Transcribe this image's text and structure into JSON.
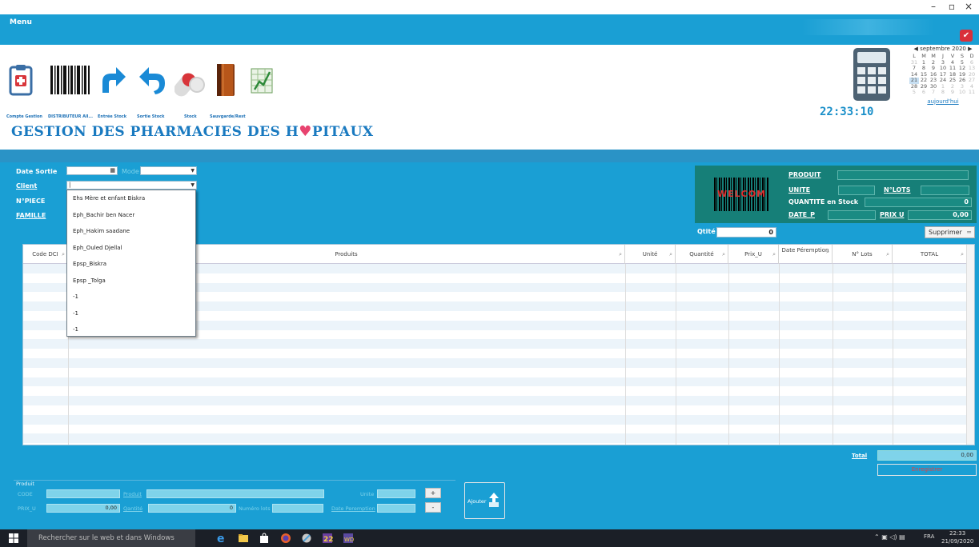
{
  "window": {
    "minimize": "–",
    "maximize": "▫",
    "close": "×"
  },
  "menu": {
    "label": "Menu"
  },
  "toolbar": {
    "labels": [
      "Compte Gestion",
      "DISTRIBUTEUR All...",
      "Entrée Stock",
      "Sortie Stock",
      "Stock",
      "Sauvgarde/Rest"
    ]
  },
  "app_title": {
    "before": "GESTION DES PHARMACIES DES H",
    "heart": "♥",
    "after": "PITAUX"
  },
  "clock": "22:33:10",
  "calendar": {
    "header": "septembre 2020",
    "prev": "◀",
    "next": "▶",
    "days": [
      "L",
      "M",
      "M",
      "J",
      "V",
      "S",
      "D"
    ],
    "weeks": [
      [
        "31",
        "1",
        "2",
        "3",
        "4",
        "5",
        "6"
      ],
      [
        "7",
        "8",
        "9",
        "10",
        "11",
        "12",
        "13"
      ],
      [
        "14",
        "15",
        "16",
        "17",
        "18",
        "19",
        "20"
      ],
      [
        "21",
        "22",
        "23",
        "24",
        "25",
        "26",
        "27"
      ],
      [
        "28",
        "29",
        "30",
        "1",
        "2",
        "3",
        "4"
      ],
      [
        "5",
        "6",
        "7",
        "8",
        "9",
        "10",
        "11"
      ]
    ],
    "today": "aujourd'hui"
  },
  "form": {
    "date_sortie": "Date Sortie",
    "mode": "Mode",
    "client": "Client",
    "client_value": "|",
    "n_piece": "N°PIECE",
    "famille": "FAMILLE"
  },
  "client_options": [
    "Ehs Mère et enfant Biskra",
    "Eph_Bachir ben Nacer",
    "Eph_Hakim saadane",
    "Eph_Ouled Djellal",
    "Epsp_Biskra",
    "Epsp _Tolga",
    "-1",
    "-1",
    "-1"
  ],
  "product_panel": {
    "logo": "WELCOM",
    "produit": "PRODUIT",
    "unite": "UNITE",
    "n_lots": "N°LOTS",
    "quantite_stock": "QUANTITE en Stock",
    "quantite_stock_value": "0",
    "date_p": "DATE_P",
    "prix_u": "PRIX U",
    "prix_u_value": "0,00"
  },
  "qtite": {
    "label": "Qtité",
    "value": "0"
  },
  "supprimer": "Supprimer",
  "grid": {
    "columns": [
      "Code DCI",
      "Produits",
      "Unité",
      "Quantité",
      "Prix_U",
      "Date Péremption",
      "N° Lots",
      "TOTAL"
    ]
  },
  "total": {
    "label": "Total",
    "value": "0,00"
  },
  "enregistrer": "Enregistrer",
  "bottom": {
    "section": "Produit",
    "code": "CODE",
    "produit": "Produit",
    "unite": "Unite",
    "prix_u": "PRIX_U",
    "prix_u_value": "0,00",
    "quantite": "Qantité",
    "quantite_value": "0",
    "numero_lots": "Numéro lots",
    "date_peremption": "Date Peremption",
    "plus": "+",
    "minus": "-",
    "ajouter": "Ajouter"
  },
  "taskbar": {
    "search": "Rechercher sur le web et dans Windows",
    "lang": "FRA",
    "time": "22:33",
    "date": "21/09/2020"
  }
}
